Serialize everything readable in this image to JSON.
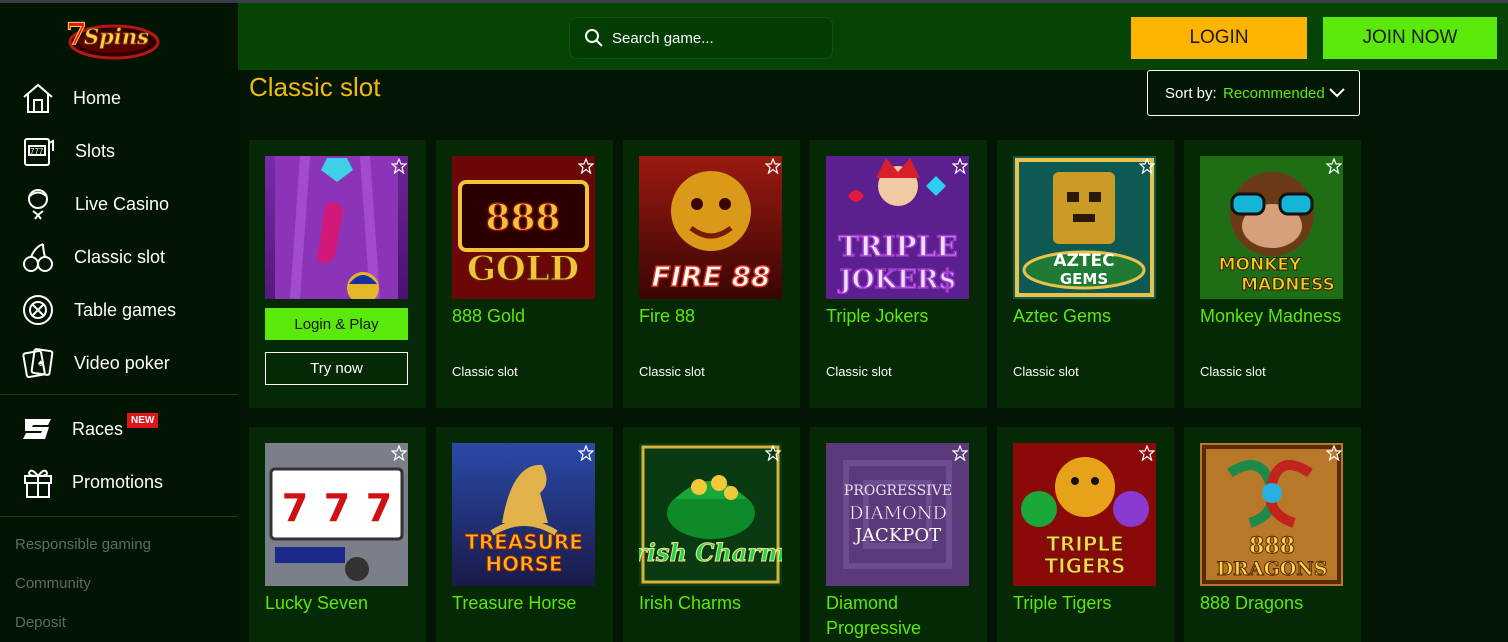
{
  "brand": {
    "logo_text": "7Spins"
  },
  "sidebar": {
    "items": [
      {
        "label": "Home",
        "icon": "home-icon"
      },
      {
        "label": "Slots",
        "icon": "slot-machine-icon"
      },
      {
        "label": "Live Casino",
        "icon": "dealer-icon"
      },
      {
        "label": "Classic slot",
        "icon": "cherries-icon"
      },
      {
        "label": "Table games",
        "icon": "poker-chip-icon"
      },
      {
        "label": "Video poker",
        "icon": "cards-icon"
      },
      {
        "label": "Races",
        "icon": "races-icon",
        "badge": "NEW"
      },
      {
        "label": "Promotions",
        "icon": "gift-icon"
      }
    ],
    "footer_links": [
      "Responsible gaming",
      "Community",
      "Deposit"
    ]
  },
  "header": {
    "search_placeholder": "Search game...",
    "login_label": "LOGIN",
    "join_label": "JOIN NOW"
  },
  "main": {
    "title": "Classic slot",
    "sort_label": "Sort by:",
    "sort_value": "Recommended",
    "login_play_label": "Login & Play",
    "try_now_label": "Try now",
    "games": [
      {
        "name": "",
        "category": ""
      },
      {
        "name": "888 Gold",
        "category": "Classic slot",
        "thumb_text": "888 GOLD"
      },
      {
        "name": "Fire 88",
        "category": "Classic slot",
        "thumb_text": "FIRE 88"
      },
      {
        "name": "Triple Jokers",
        "category": "Classic slot",
        "thumb_text": "TRIPLE JOKER$"
      },
      {
        "name": "Aztec Gems",
        "category": "Classic slot",
        "thumb_text": "AZTEC GEMS"
      },
      {
        "name": "Monkey Madness",
        "category": "Classic slot",
        "thumb_text": "MONKEY MADNESS"
      },
      {
        "name": "Lucky Seven",
        "category": "",
        "thumb_text": "777"
      },
      {
        "name": "Treasure Horse",
        "category": "",
        "thumb_text": "TREASURE HORSE"
      },
      {
        "name": "Irish Charms",
        "category": "",
        "thumb_text": "Irish Charms"
      },
      {
        "name": "Diamond Progressive",
        "category": "",
        "thumb_text": "PROGRESSIVE DIAMOND JACKPOT"
      },
      {
        "name": "Triple Tigers",
        "category": "",
        "thumb_text": "TRIPLE TIGERS"
      },
      {
        "name": "888 Dragons",
        "category": "",
        "thumb_text": "888 DRAGONS"
      }
    ]
  },
  "colors": {
    "accent_green": "#5be80b",
    "accent_yellow": "#fdb400",
    "title_gold": "#f2b90d",
    "header_bg": "#054405",
    "card_bg": "#042904"
  }
}
